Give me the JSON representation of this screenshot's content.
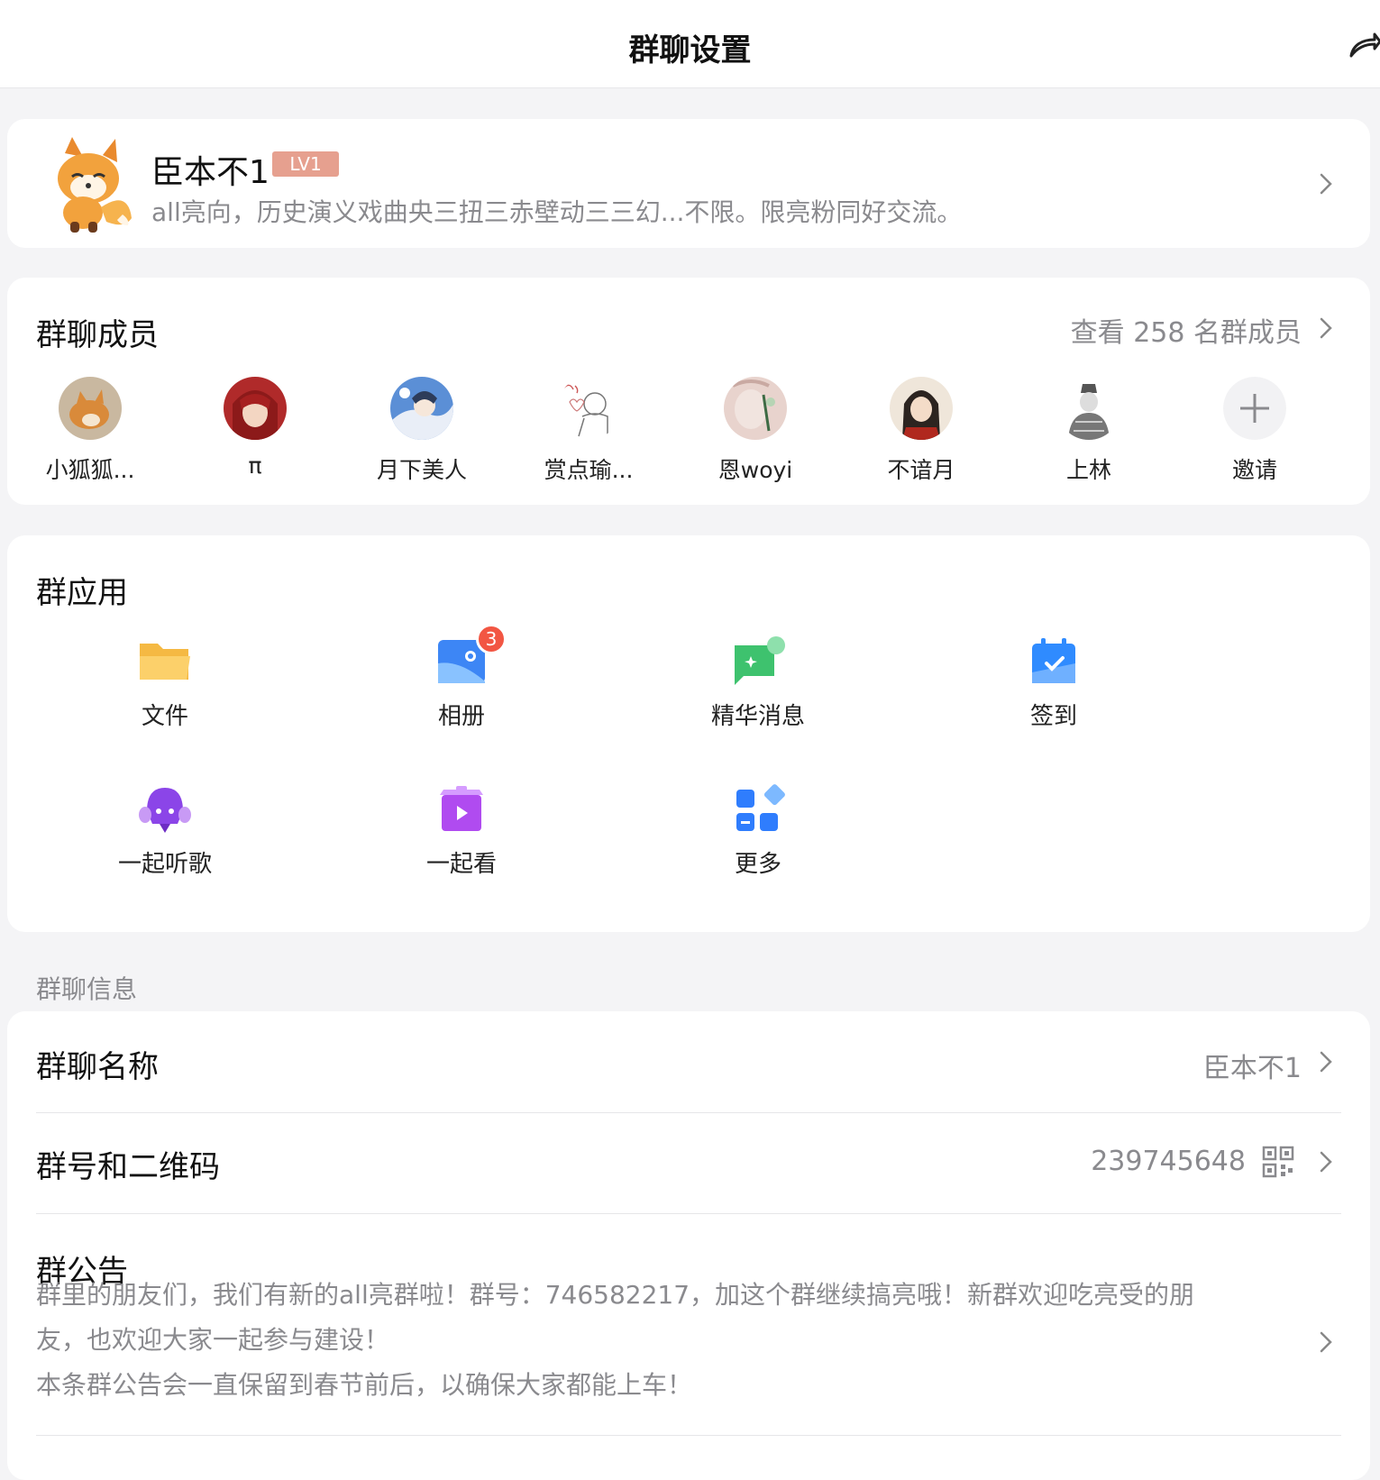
{
  "header": {
    "title": "群聊设置",
    "share_icon": "share-arrow-icon"
  },
  "profile": {
    "name": "臣本不1",
    "level": "LV1",
    "level_color": "#e6a08f",
    "description": "all亮向，历史演义戏曲央三扭三赤壁动三三幻...不限。限亮粉同好交流。"
  },
  "members": {
    "title": "群聊成员",
    "view_all": "查看 258 名群成员",
    "list": [
      {
        "name": "小狐狐..."
      },
      {
        "name": "π"
      },
      {
        "name": "月下美人"
      },
      {
        "name": "赏点瑜..."
      },
      {
        "name": "恩woyi"
      },
      {
        "name": "不谙月"
      },
      {
        "name": "上林"
      },
      {
        "name": "邀请"
      }
    ]
  },
  "apps": {
    "title": "群应用",
    "items": [
      {
        "label": "文件",
        "icon": "folder-icon"
      },
      {
        "label": "相册",
        "icon": "album-icon",
        "badge": "3"
      },
      {
        "label": "精华消息",
        "icon": "featured-message-icon"
      },
      {
        "label": "签到",
        "icon": "checkin-calendar-icon"
      },
      {
        "label": "一起听歌",
        "icon": "listen-together-icon"
      },
      {
        "label": "一起看",
        "icon": "watch-together-icon"
      },
      {
        "label": "更多",
        "icon": "more-apps-icon"
      }
    ]
  },
  "info": {
    "section_label": "群聊信息",
    "group_name": {
      "label": "群聊名称",
      "value": "臣本不1"
    },
    "group_id": {
      "label": "群号和二维码",
      "value": "239745648"
    },
    "notice": {
      "label": "群公告",
      "lines": [
        "群里的朋友们，我们有新的all亮群啦！群号：746582217，加这个群继续搞亮哦！新群欢迎吃亮受的朋",
        "友，也欢迎大家一起参与建设！",
        "本条群公告会一直保留到春节前后，以确保大家都能上车！"
      ]
    }
  }
}
